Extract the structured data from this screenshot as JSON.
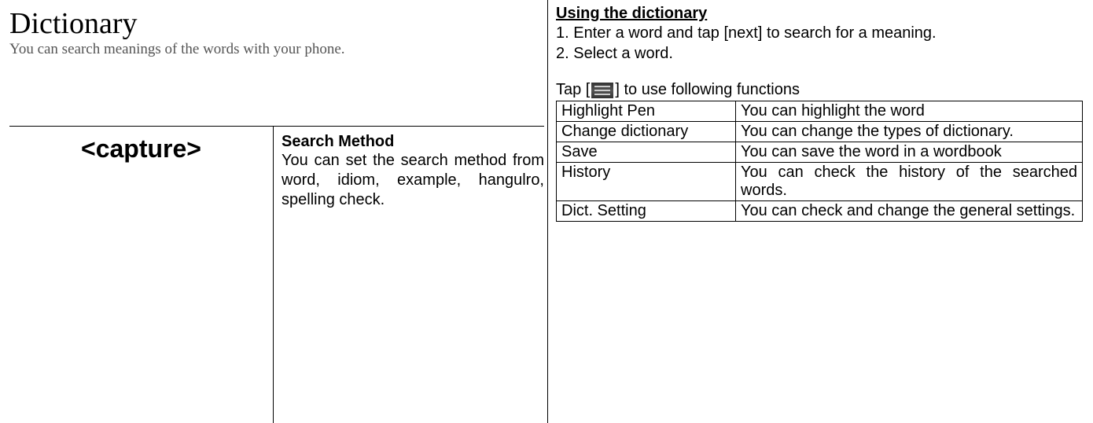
{
  "title": "Dictionary",
  "subtitle": "You can search meanings of the words with your phone.",
  "capture_label": "<capture>",
  "search_method": {
    "heading": "Search Method",
    "description": "You can set the search method from word, idiom, example, hangulro, spelling check."
  },
  "using": {
    "heading": "Using the dictionary",
    "steps": [
      "1. Enter a word and tap [next] to search for a meaning.",
      "2. Select a word."
    ],
    "tap_prefix": "Tap [",
    "tap_suffix": "] to use following functions"
  },
  "functions": [
    {
      "name": "Highlight Pen",
      "desc": "You can highlight the word"
    },
    {
      "name": "Change dictionary",
      "desc": "You can change the types of dictionary."
    },
    {
      "name": "Save",
      "desc": "You can save the word in a wordbook"
    },
    {
      "name": "History",
      "desc": "You can check the history of the searched words."
    },
    {
      "name": "Dict. Setting",
      "desc": "You can check and change the general settings."
    }
  ]
}
